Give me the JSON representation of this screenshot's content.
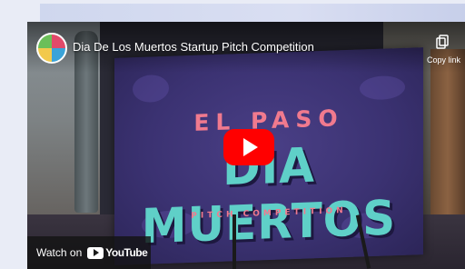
{
  "video": {
    "title": "Dia De Los Muertos Startup Pitch Competition",
    "copy_link_label": "Copy link"
  },
  "banner": {
    "line1": "EL PASO",
    "line2": "DIA MUERTOS",
    "line3": "PITCH COMPETITION"
  },
  "footer": {
    "watch_on": "Watch on",
    "platform": "YouTube"
  },
  "colors": {
    "play_button": "#ff0000",
    "banner_accent": "#f07a8e",
    "banner_title": "#5fd0c8"
  },
  "icons": {
    "channel": "channel-avatar-icon",
    "copy": "copy-link-icon",
    "play": "play-icon",
    "youtube": "youtube-logo-icon"
  }
}
